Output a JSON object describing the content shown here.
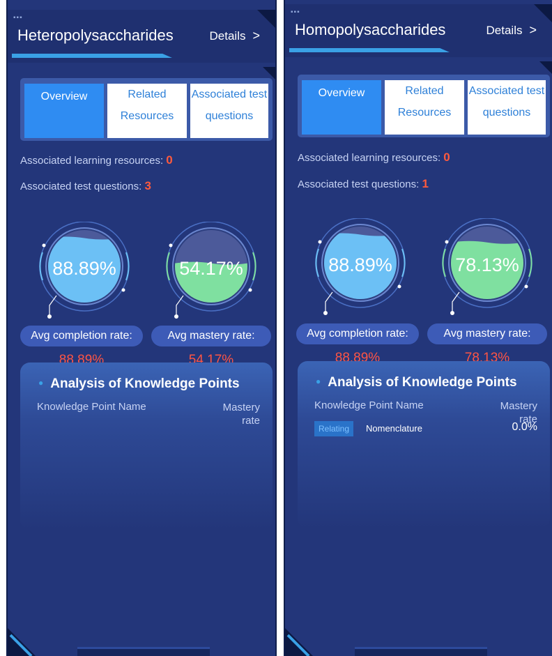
{
  "panels": [
    {
      "title": "Heteropolysaccharides",
      "details_label": "Details",
      "tabs": {
        "overview": "Overview",
        "related_1": "Related",
        "related_2": "Resources",
        "assoc_1": "Associated test",
        "assoc_2": "questions"
      },
      "learning_resources_label": "Associated learning resources:",
      "learning_resources_count": "0",
      "test_questions_label": "Associated test questions:",
      "test_questions_count": "3",
      "completion_gauge_text": "88.89%",
      "completion_fraction": 0.8889,
      "mastery_gauge_text": "54.17%",
      "mastery_fraction": 0.5417,
      "completion_label": "Avg completion rate:",
      "completion_value": "88.89%",
      "mastery_label": "Avg mastery rate:",
      "mastery_value": "54.17%",
      "analysis_title": "Analysis of Knowledge Points",
      "col_name": "Knowledge Point Name",
      "col_rate": "Mastery rate",
      "rows": []
    },
    {
      "title": "Homopolysaccharides",
      "details_label": "Details",
      "tabs": {
        "overview": "Overview",
        "related_1": "Related",
        "related_2": "Resources",
        "assoc_1": "Associated test",
        "assoc_2": "questions"
      },
      "learning_resources_label": "Associated learning resources:",
      "learning_resources_count": "0",
      "test_questions_label": "Associated test questions:",
      "test_questions_count": "1",
      "completion_gauge_text": "88.89%",
      "completion_fraction": 0.8889,
      "mastery_gauge_text": "78.13%",
      "mastery_fraction": 0.7813,
      "completion_label": "Avg completion rate:",
      "completion_value": "88.89%",
      "mastery_label": "Avg mastery rate:",
      "mastery_value": "78.13%",
      "analysis_title": "Analysis of Knowledge Points",
      "col_name": "Knowledge Point Name",
      "col_rate": "Mastery rate",
      "rows": [
        {
          "tag": "Relating",
          "name": "Nomenclature",
          "rate": "0.0%"
        }
      ]
    }
  ],
  "colors": {
    "panel_bg": "#23367a",
    "accent_blue": "#2f8cf2",
    "count_red": "#ff5a3d",
    "completion_fill": "#6cc0f5",
    "mastery_fill": "#7fe0a0"
  },
  "icons": {
    "details": "chevron-right-icon",
    "bullet": "bullet-dot-icon"
  }
}
